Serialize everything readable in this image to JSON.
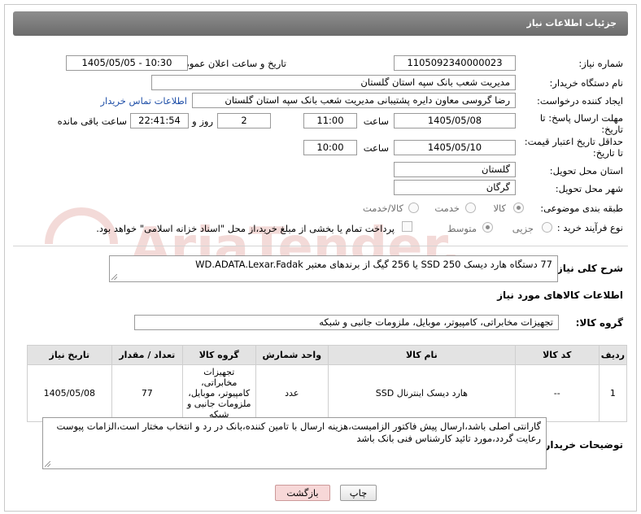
{
  "header": {
    "title": "جزئیات اطلاعات نیاز"
  },
  "fields": {
    "need_number_label": "شماره نیاز:",
    "need_number": "1105092340000023",
    "announce_label": "تاریخ و ساعت اعلان عمومی:",
    "announce_value": "1405/05/05 - 10:30",
    "buyer_label": "نام دستگاه خریدار:",
    "buyer_value": "مدیریت شعب بانک سپه استان گلستان",
    "creator_label": "ایجاد کننده درخواست:",
    "creator_value": "رضا گروسی معاون دایره پشتیبانی مدیریت شعب بانک سپه استان گلستان",
    "contact_link": "اطلاعات تماس خریدار",
    "deadline_label_1": "مهلت ارسال پاسخ: تا",
    "deadline_label_2": "تاریخ:",
    "deadline_date": "1405/05/08",
    "time_label": "ساعت",
    "deadline_time": "11:00",
    "days_value": "2",
    "days_label": "روز و",
    "remaining_time": "22:41:54",
    "remaining_label": "ساعت باقی مانده",
    "validity_label_1": "حداقل تاریخ اعتبار قیمت:",
    "validity_label_2": "تا تاریخ:",
    "validity_date": "1405/05/10",
    "validity_time": "10:00",
    "province_label": "استان محل تحویل:",
    "province_value": "گلستان",
    "city_label": "شهر محل تحویل:",
    "city_value": "گرگان",
    "category_label": "طبقه بندی موضوعی:",
    "category_options": [
      "کالا",
      "خدمت",
      "کالا/خدمت"
    ],
    "process_label": "نوع فرآیند خرید :",
    "process_options": [
      "جزیی",
      "متوسط"
    ],
    "payment_note": "پرداخت تمام یا بخشی از مبلغ خرید،از محل \"اسناد خزانه اسلامی\" خواهد بود."
  },
  "description": {
    "label": "شرح کلی نیاز:",
    "value": "77 دستگاه هارد دیسک SSD 250 یا 256 گیگ از برندهای معتبر WD.ADATA.Lexar.Fadak"
  },
  "goods_info": {
    "title": "اطلاعات کالاهای مورد نیاز",
    "group_label": "گروه کالا:",
    "group_value": "تجهیزات مخابراتی، کامپیوتر، موبایل، ملزومات جانبی و شبکه"
  },
  "table": {
    "headers": [
      "ردیف",
      "کد کالا",
      "نام کالا",
      "واحد شمارش",
      "گروه کالا",
      "تعداد / مقدار",
      "تاریخ نیاز"
    ],
    "rows": [
      [
        "1",
        "--",
        "هارد دیسک اینترنال SSD",
        "عدد",
        "تجهیزات مخابراتی، کامپیوتر، موبایل، ملزومات جانبی و شبکه",
        "77",
        "1405/05/08"
      ]
    ]
  },
  "buyer_notes": {
    "label": "توضیحات خریدار:",
    "value": "گارانتی اصلی باشد،ارسال پیش فاکتور الزامیست،هزینه ارسال با تامین کننده،بانک در رد و انتخاب مختار است،الزامات پیوست رعایت گردد،مورد تائید کارشناس فنی بانک باشد"
  },
  "buttons": {
    "print": "چاپ",
    "back": "بازگشت"
  },
  "watermark_text": "AriaTender.neT",
  "colors": {
    "header": "#7a7a7a",
    "link": "#1f4fa8",
    "back_button": "#f7d8d8",
    "table_header": "#e3e3e3"
  }
}
